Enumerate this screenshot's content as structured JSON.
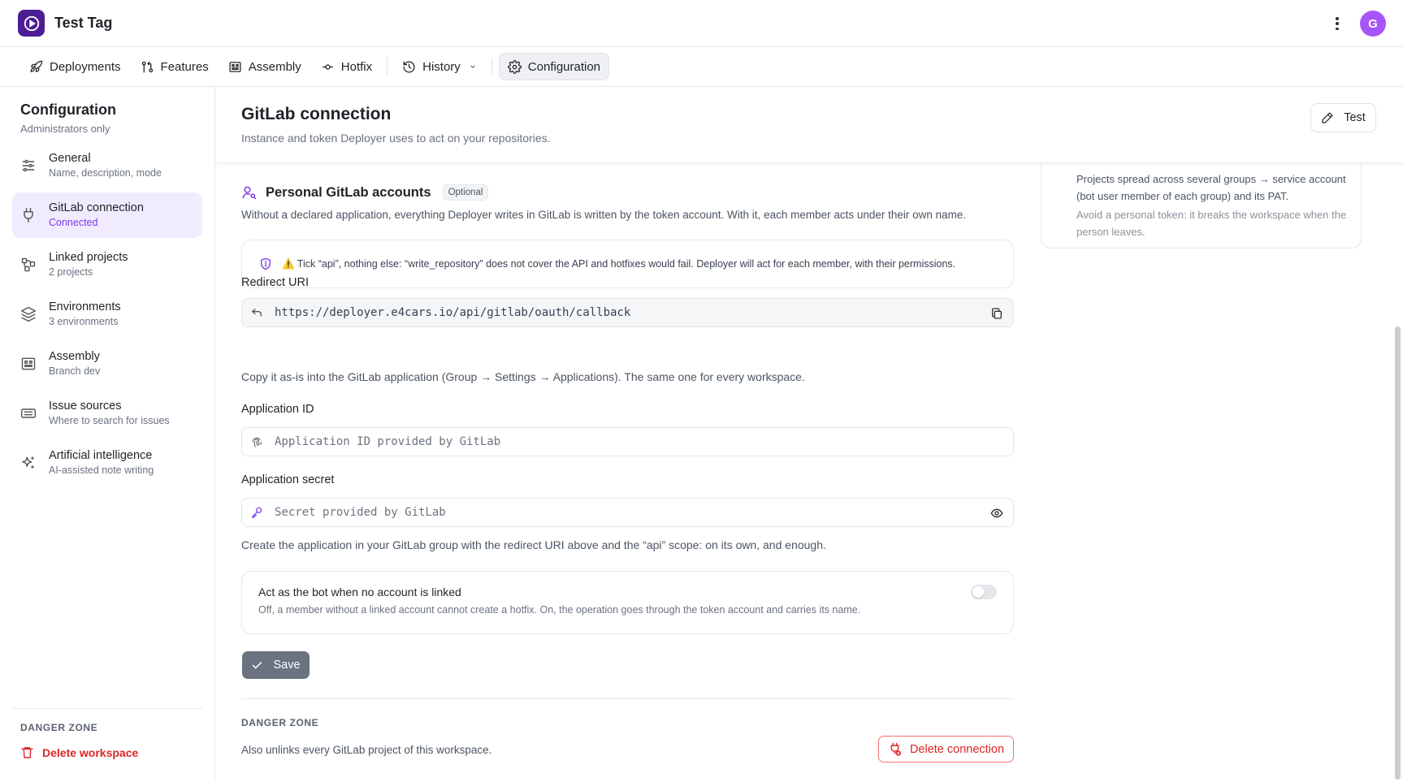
{
  "app": {
    "title": "Test Tag",
    "avatar_initial": "G"
  },
  "nav": {
    "items": [
      {
        "label": "Deployments",
        "icon": "rocket-icon"
      },
      {
        "label": "Features",
        "icon": "git-pull-request-icon"
      },
      {
        "label": "Assembly",
        "icon": "assembly-icon"
      },
      {
        "label": "Hotfix",
        "icon": "git-commit-icon"
      },
      {
        "label": "History",
        "icon": "history-icon"
      },
      {
        "label": "Configuration",
        "icon": "gear-icon",
        "active": true
      }
    ]
  },
  "sidebar": {
    "title": "Configuration",
    "subtitle": "Administrators only",
    "items": [
      {
        "label": "General",
        "desc": "Name, description, mode",
        "icon": "sliders-icon"
      },
      {
        "label": "GitLab connection",
        "desc": "Connected",
        "icon": "plug-icon",
        "active": true
      },
      {
        "label": "Linked projects",
        "desc": "2 projects",
        "icon": "workflow-icon"
      },
      {
        "label": "Environments",
        "desc": "3 environments",
        "icon": "layers-icon"
      },
      {
        "label": "Assembly",
        "desc": "Branch dev",
        "icon": "assembly-icon"
      },
      {
        "label": "Issue sources",
        "desc": "Where to search for issues",
        "icon": "ticket-icon"
      },
      {
        "label": "Artificial intelligence",
        "desc": "AI-assisted note writing",
        "icon": "sparkles-icon"
      }
    ],
    "danger_label": "DANGER ZONE",
    "delete_workspace": "Delete workspace"
  },
  "header": {
    "title": "GitLab connection",
    "subtitle": "Instance and token Deployer uses to act on your repositories.",
    "test_button": "Test"
  },
  "side_note": {
    "text1": "Projects spread across several groups → service account (bot user member of each group) and its PAT.",
    "text2": "Avoid a personal token: it breaks the workspace when the person leaves."
  },
  "section": {
    "title": "Personal GitLab accounts",
    "badge": "Optional",
    "description": "Without a declared application, everything Deployer writes in GitLab is written by the token account. With it, each member acts under their own name.",
    "alert": "⚠️ Tick “api”, nothing else: “write_repository” does not cover the API and hotfixes would fail. Deployer will act for each member, with their permissions."
  },
  "redirect_uri": {
    "label": "Redirect URI",
    "value": "https://deployer.e4cars.io/api/gitlab/oauth/callback",
    "help": "Copy it as-is into the GitLab application (Group → Settings → Applications). The same one for every workspace."
  },
  "application_id": {
    "label": "Application ID",
    "placeholder": "Application ID provided by GitLab"
  },
  "application_secret": {
    "label": "Application secret",
    "placeholder": "Secret provided by GitLab",
    "help": "Create the application in your GitLab group with the redirect URI above and the “api” scope: on its own, and enough."
  },
  "bot_toggle": {
    "title": "Act as the bot when no account is linked",
    "description": "Off, a member without a linked account cannot create a hotfix. On, the operation goes through the token account and carries its name.",
    "enabled": false
  },
  "save_button": "Save",
  "danger_zone": {
    "label": "DANGER ZONE",
    "description": "Also unlinks every GitLab project of this workspace.",
    "delete_button": "Delete connection"
  },
  "colors": {
    "accent": "#7c3aed",
    "danger": "#dc2626",
    "active_bg": "#f0ebfe"
  }
}
